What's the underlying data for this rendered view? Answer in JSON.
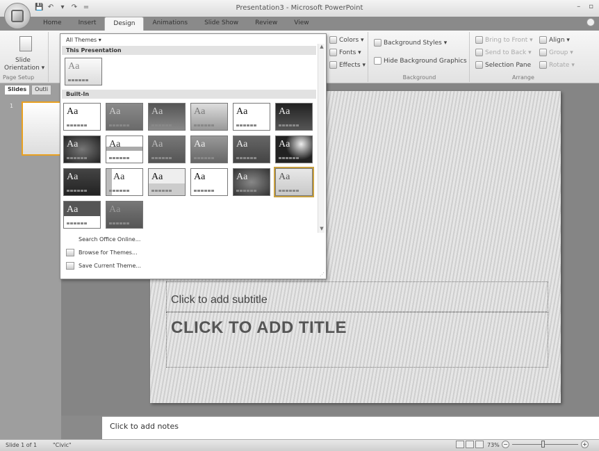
{
  "window": {
    "title": "Presentation3 - Microsoft PowerPoint",
    "minimize": "–",
    "maximize": "▫"
  },
  "quick_access": {
    "save": "💾",
    "undo": "↶",
    "undo_arrow": "▾",
    "redo": "↷",
    "customize": "="
  },
  "tabs": [
    "Home",
    "Insert",
    "Design",
    "Animations",
    "Slide Show",
    "Review",
    "View"
  ],
  "ribbon": {
    "page_setup": {
      "orientation_line1": "Slide",
      "orientation_line2": "Orientation ▾",
      "group_label": "Page Setup"
    },
    "themes": {
      "colors": "Colors ▾",
      "fonts": "Fonts ▾",
      "effects": "Effects ▾"
    },
    "background": {
      "styles": "Background Styles ▾",
      "hide_graphics": "Hide Background Graphics",
      "group_label": "Background"
    },
    "arrange": {
      "bring_to_front": "Bring to Front ▾",
      "send_to_back": "Send to Back ▾",
      "selection_pane": "Selection Pane",
      "align": "Align ▾",
      "group": "Group ▾",
      "rotate": "Rotate ▾",
      "group_label": "Arrange"
    }
  },
  "left_pane": {
    "slides_tab": "Slides",
    "outline_tab": "Outli",
    "slide_number": "1"
  },
  "themes_dropdown": {
    "header": "All Themes ▾",
    "this_presentation": "This Presentation",
    "built_in": "Built-In",
    "theme_sample": "Aa",
    "this_theme_sample": "Aa",
    "menu": {
      "search_online": "Search Office Online...",
      "browse": "Browse for Themes...",
      "save_current": "Save Current Theme..."
    }
  },
  "slide": {
    "subtitle_placeholder": "Click to add subtitle",
    "title_placeholder": "CLICK TO ADD TITLE"
  },
  "notes": {
    "placeholder": "Click to add notes"
  },
  "status": {
    "slide_info": "Slide 1 of 1",
    "theme_name": "\"Civic\"",
    "zoom": "73%",
    "zoom_minus": "−",
    "zoom_plus": "+"
  }
}
